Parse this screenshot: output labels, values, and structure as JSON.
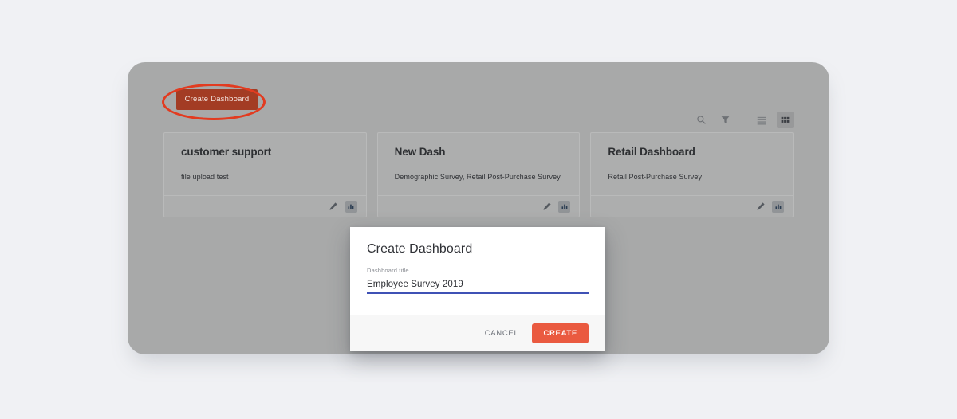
{
  "app": {
    "create_dashboard_button": "Create Dashboard"
  },
  "toolbar": {
    "items": [
      {
        "name": "search-icon",
        "label": "Search",
        "active": false
      },
      {
        "name": "filter-icon",
        "label": "Filter",
        "active": false
      },
      {
        "name": "list-view-icon",
        "label": "List view",
        "active": false
      },
      {
        "name": "grid-view-icon",
        "label": "Grid view",
        "active": true
      }
    ]
  },
  "cards": [
    {
      "title": "customer support",
      "subtitle": "file upload test",
      "edit_icon": "pencil-icon",
      "chart_icon": "bar-chart-icon"
    },
    {
      "title": "New Dash",
      "subtitle": "Demographic Survey, Retail Post-Purchase Survey",
      "edit_icon": "pencil-icon",
      "chart_icon": "bar-chart-icon"
    },
    {
      "title": "Retail Dashboard",
      "subtitle": "Retail Post-Purchase Survey",
      "edit_icon": "pencil-icon",
      "chart_icon": "bar-chart-icon"
    }
  ],
  "modal": {
    "title": "Create Dashboard",
    "field_label": "Dashboard title",
    "field_value": "Employee Survey 2019",
    "field_placeholder": "",
    "cancel_label": "CANCEL",
    "create_label": "CREATE"
  },
  "colors": {
    "page_background": "#f0f1f4",
    "stage_background": "#a8a9a9",
    "create_button": "#a33c24",
    "annotation_ellipse": "#e23b20",
    "primary_action": "#ea5a40",
    "input_underline": "#3f51b5",
    "card_background": "#adaeae"
  }
}
